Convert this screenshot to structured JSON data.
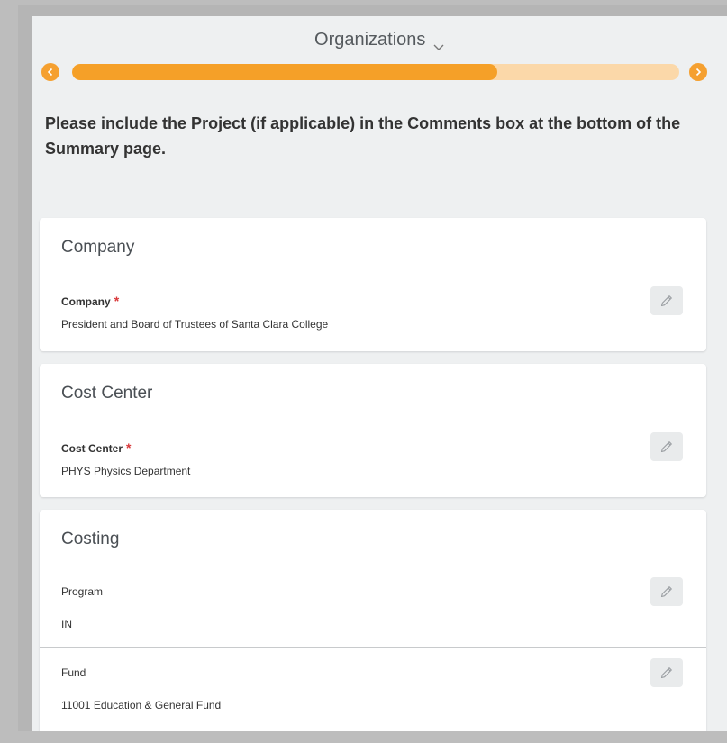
{
  "header": {
    "title": "Organizations",
    "progress_percent": 70,
    "icons": {
      "chevron": "chevron-down-icon",
      "prev": "chevron-left-icon",
      "next": "chevron-right-icon"
    }
  },
  "instruction": "Please include the Project (if applicable) in the Comments box at the bottom of the Summary page.",
  "colors": {
    "accent": "#f5a028",
    "accent_light": "#fbd8a9",
    "required": "#d9383a",
    "panel_bg": "#eef0f1"
  },
  "cards": {
    "company": {
      "title": "Company",
      "field_label": "Company",
      "required_mark": "*",
      "value": "President and Board of Trustees of Santa Clara College"
    },
    "cost_center": {
      "title": "Cost Center",
      "field_label": "Cost Center",
      "required_mark": "*",
      "value": "PHYS Physics Department"
    },
    "costing": {
      "title": "Costing",
      "program_label": "Program",
      "program_value": "IN",
      "fund_label": "Fund",
      "fund_value": "11001 Education & General Fund"
    }
  },
  "edit_icon": "pencil-icon"
}
